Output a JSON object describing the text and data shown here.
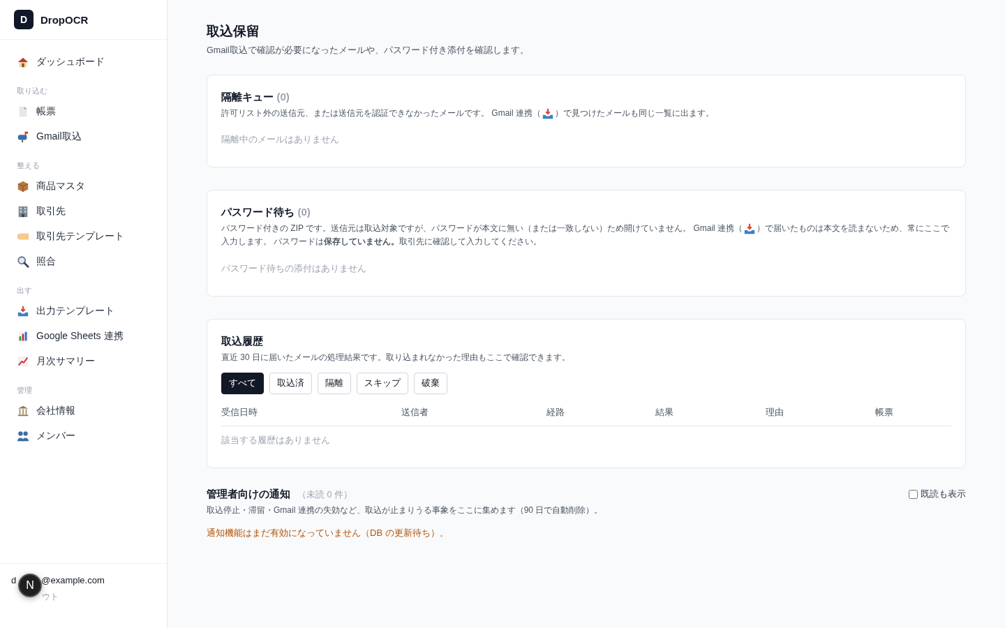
{
  "sidebar": {
    "brand": {
      "logo": "D",
      "name": "DropOCR"
    },
    "sections": [
      {
        "items": [
          {
            "label": "ダッシュボード",
            "kind": "house"
          }
        ]
      },
      {
        "heading": "取り込む",
        "items": [
          {
            "label": "帳票",
            "kind": "document"
          },
          {
            "label": "Gmail取込",
            "kind": "mailbox"
          }
        ]
      },
      {
        "heading": "整える",
        "items": [
          {
            "label": "商品マスタ",
            "kind": "package"
          },
          {
            "label": "取引先",
            "kind": "building"
          },
          {
            "label": "取引先テンプレート",
            "kind": "tag"
          },
          {
            "label": "照合",
            "kind": "search"
          }
        ]
      },
      {
        "heading": "出す",
        "items": [
          {
            "label": "出力テンプレート",
            "kind": "tray"
          },
          {
            "label": "Google Sheets 連携",
            "kind": "barchart"
          },
          {
            "label": "月次サマリー",
            "kind": "linechart"
          }
        ]
      },
      {
        "heading": "管理",
        "items": [
          {
            "label": "会社情報",
            "kind": "bank"
          },
          {
            "label": "メンバー",
            "kind": "people"
          }
        ]
      }
    ],
    "footer": {
      "email_parts": [
        "d",
        "@example.com"
      ],
      "logout_parts": [
        "ウト"
      ],
      "badge": "N"
    }
  },
  "page": {
    "title": "取込保留",
    "subtitle": "Gmail取込で確認が必要になったメールや、パスワード付き添付を確認します。"
  },
  "quarantine": {
    "title": "隔離キュー",
    "count": "(0)",
    "description": [
      [
        {
          "kind": "text",
          "text": "許可リスト外の送信元、または送信元を認証できなかったメールです。 Gmail 連携（"
        },
        {
          "kind": "icon"
        },
        {
          "kind": "text",
          "text": "）で見つけたメールも同じ一覧に出ます。"
        }
      ]
    ],
    "empty": "隔離中のメールはありません"
  },
  "password": {
    "title": "パスワード待ち",
    "count": "(0)",
    "description": [
      [
        {
          "kind": "text",
          "text": "パスワード付きの ZIP です。送信元は取込対象ですが、パスワードが本文に無い（または一致しない）ため開けていません。 Gmail 連携（"
        },
        {
          "kind": "icon"
        },
        {
          "kind": "text",
          "text": "）で届いたものは本文を読まないため、常にここで"
        }
      ],
      [
        {
          "kind": "text",
          "text": "入力します。 パスワードは**保存していません。**取引先に確認して入力してください。"
        }
      ]
    ],
    "empty": "パスワード待ちの添付はありません"
  },
  "history": {
    "title": "取込履歴",
    "description": "直近 30 日に届いたメールの処理結果です。取り込まれなかった理由もここで確認できます。",
    "filters": [
      {
        "label": "すべて",
        "selected": true
      },
      {
        "label": "取込済",
        "selected": false
      },
      {
        "label": "隔離",
        "selected": false
      },
      {
        "label": "スキップ",
        "selected": false
      },
      {
        "label": "破棄",
        "selected": false
      }
    ],
    "table": {
      "columns": [
        "受信日時",
        "送信者",
        "経路",
        "結果",
        "理由",
        "帳票"
      ],
      "empty": "該当する履歴はありません"
    }
  },
  "notices": {
    "title": "管理者向けの通知",
    "unread": "（未読 0 件）",
    "show_read": {
      "label": "既読も表示",
      "checked": false
    },
    "description": "取込停止・滞留・Gmail 連携の失効など、取込が止まりうる事象をここに集めます（90 日で自動削除）。",
    "warning": "通知機能はまだ有効になっていません（DB の更新待ち）。"
  }
}
